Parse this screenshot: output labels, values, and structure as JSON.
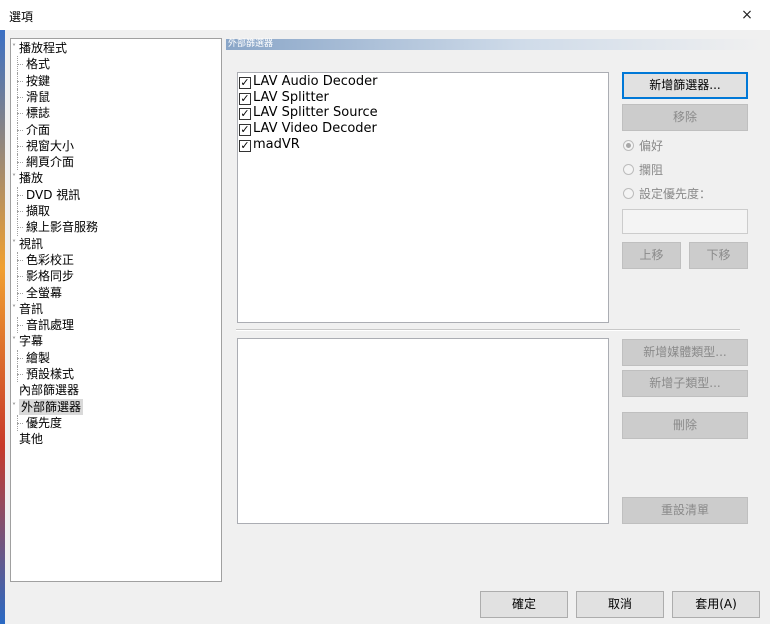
{
  "window": {
    "title": "選項",
    "close_glyph": "×"
  },
  "tree": {
    "items": [
      {
        "label": "播放程式",
        "level": 0,
        "expandable": true
      },
      {
        "label": "格式",
        "level": 1
      },
      {
        "label": "按鍵",
        "level": 1
      },
      {
        "label": "滑鼠",
        "level": 1
      },
      {
        "label": "標誌",
        "level": 1
      },
      {
        "label": "介面",
        "level": 1
      },
      {
        "label": "視窗大小",
        "level": 1
      },
      {
        "label": "網頁介面",
        "level": 1
      },
      {
        "label": "播放",
        "level": 0,
        "expandable": true
      },
      {
        "label": "DVD 視訊",
        "level": 1
      },
      {
        "label": "擷取",
        "level": 1
      },
      {
        "label": "線上影音服務",
        "level": 1
      },
      {
        "label": "視訊",
        "level": 0,
        "expandable": true
      },
      {
        "label": "色彩校正",
        "level": 1
      },
      {
        "label": "影格同步",
        "level": 1
      },
      {
        "label": "全螢幕",
        "level": 1
      },
      {
        "label": "音訊",
        "level": 0,
        "expandable": true
      },
      {
        "label": "音訊處理",
        "level": 1
      },
      {
        "label": "字幕",
        "level": 0,
        "expandable": true
      },
      {
        "label": "繪製",
        "level": 1
      },
      {
        "label": "預設樣式",
        "level": 1
      },
      {
        "label": "內部篩選器",
        "level": 0
      },
      {
        "label": "外部篩選器",
        "level": 0,
        "expandable": true,
        "selected": true
      },
      {
        "label": "優先度",
        "level": 1
      },
      {
        "label": "其他",
        "level": 0
      }
    ]
  },
  "panel": {
    "header": "外部篩選器",
    "filters": [
      {
        "label": "LAV Audio Decoder",
        "checked": true
      },
      {
        "label": "LAV Splitter",
        "checked": true
      },
      {
        "label": "LAV Splitter Source",
        "checked": true
      },
      {
        "label": "LAV Video Decoder",
        "checked": true
      },
      {
        "label": "madVR",
        "checked": true
      }
    ],
    "check_glyph": "✓",
    "add_filter_label": "新增篩選器...",
    "remove_label": "移除",
    "radio_prefer": "偏好",
    "radio_block": "攔阻",
    "radio_set_priority": "設定優先度：",
    "move_up_label": "上移",
    "move_down_label": "下移",
    "add_media_type_label": "新增媒體類型...",
    "add_subtype_label": "新增子類型...",
    "delete_label": "刪除",
    "reset_list_label": "重設清單"
  },
  "footer": {
    "ok_label": "確定",
    "cancel_label": "取消",
    "apply_label": "套用(A)"
  }
}
